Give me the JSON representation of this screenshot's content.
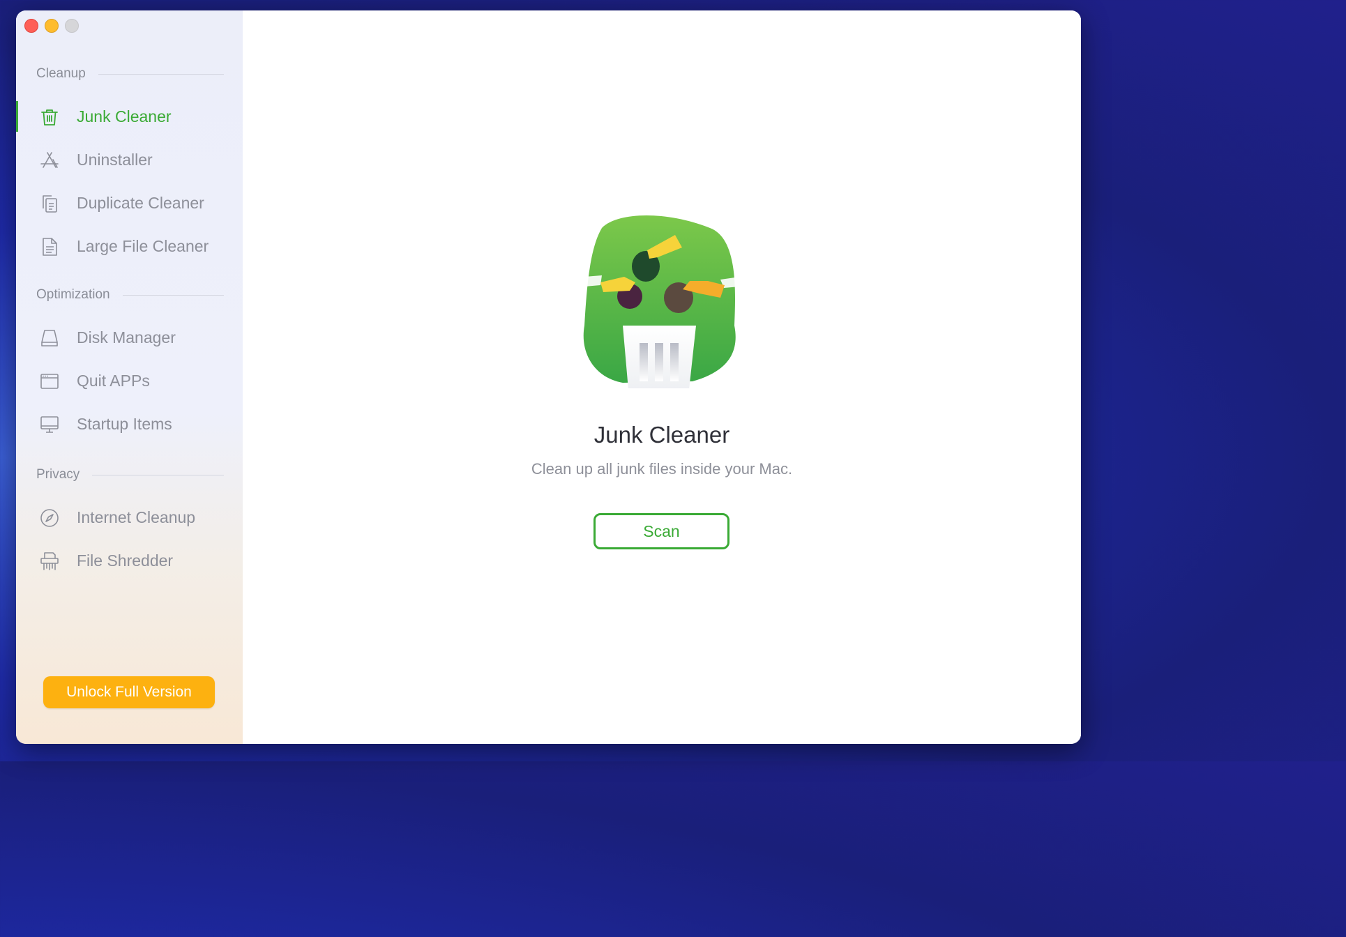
{
  "window": {
    "controls": [
      "close",
      "minimize",
      "zoom"
    ]
  },
  "sidebar": {
    "sections": [
      {
        "title": "Cleanup"
      },
      {
        "title": "Optimization"
      },
      {
        "title": "Privacy"
      }
    ],
    "items": [
      {
        "label": "Junk Cleaner",
        "icon": "trash-icon",
        "active": true
      },
      {
        "label": "Uninstaller",
        "icon": "app-store-icon"
      },
      {
        "label": "Duplicate Cleaner",
        "icon": "duplicate-files-icon"
      },
      {
        "label": "Large File Cleaner",
        "icon": "document-icon"
      },
      {
        "label": "Disk Manager",
        "icon": "disk-icon"
      },
      {
        "label": "Quit APPs",
        "icon": "window-icon"
      },
      {
        "label": "Startup Items",
        "icon": "monitor-icon"
      },
      {
        "label": "Internet Cleanup",
        "icon": "compass-icon"
      },
      {
        "label": "File Shredder",
        "icon": "shredder-icon"
      }
    ],
    "unlock_label": "Unlock Full Version"
  },
  "main": {
    "illustration": "junk-cleaner-illustration",
    "title": "Junk Cleaner",
    "subtitle": "Clean up all junk files inside your Mac.",
    "scan_label": "Scan"
  },
  "colors": {
    "accent_green": "#3aaa35",
    "unlock_orange": "#fdb110",
    "muted_text": "#8d8f99"
  }
}
